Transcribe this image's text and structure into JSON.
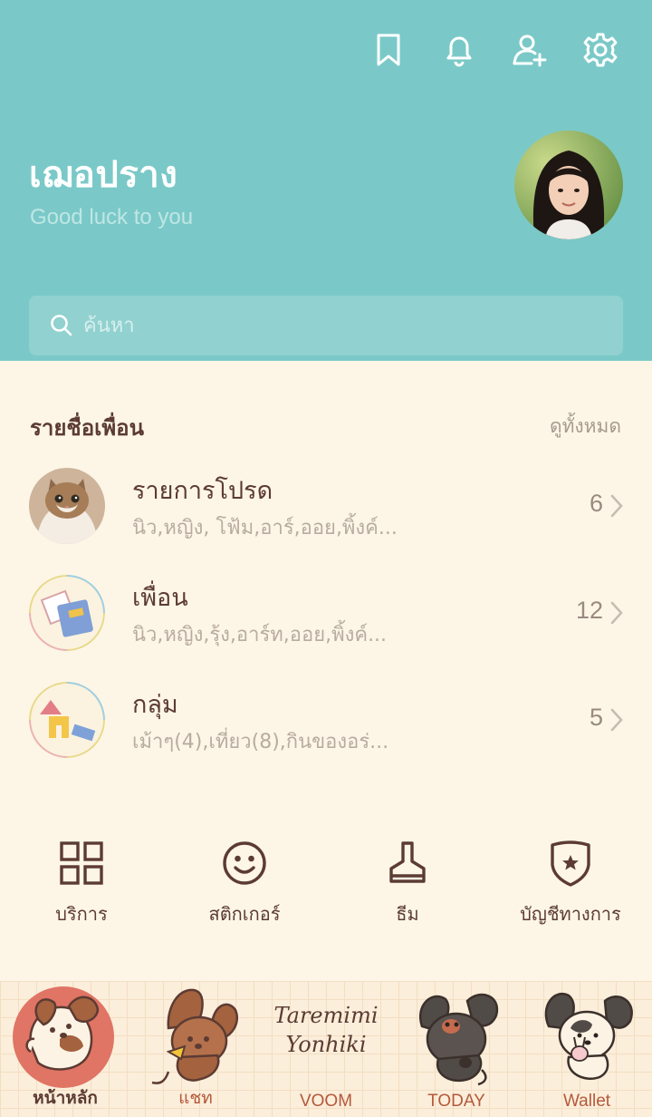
{
  "header": {
    "profile_name": "เฌอปราง",
    "status_message": "Good luck to you",
    "top_icons": [
      "bookmark-icon",
      "bell-icon",
      "add-friend-icon",
      "gear-icon"
    ]
  },
  "search": {
    "placeholder": "ค้นหา"
  },
  "friends": {
    "title": "รายชื่อเพื่อน",
    "see_all": "ดูทั้งหมด",
    "items": [
      {
        "title": "รายการโปรด",
        "subtitle": "นิว,หญิง, โฟ้ม,อาร์,ออย,พิ้งค์...",
        "count": "6"
      },
      {
        "title": "เพื่อน",
        "subtitle": "นิว,หญิง,รุ้ง,อาร์ท,ออย,พิ้งค์...",
        "count": "12"
      },
      {
        "title": "กลุ่ม",
        "subtitle": "เม้าๆ(4),เที่ยว(8),กินของอร่...",
        "count": "5"
      }
    ]
  },
  "shortcuts": [
    {
      "label": "บริการ",
      "icon": "grid-icon"
    },
    {
      "label": "สติกเกอร์",
      "icon": "smiley-icon"
    },
    {
      "label": "ธีม",
      "icon": "brush-icon"
    },
    {
      "label": "บัญชีทางการ",
      "icon": "shield-star-icon"
    }
  ],
  "bottom_nav": {
    "logo_text_1": "Taremimi",
    "logo_text_2": "Yonhiki",
    "items": [
      {
        "label": "หน้าหลัก",
        "active": true
      },
      {
        "label": "แชท",
        "active": false
      },
      {
        "label": "VOOM",
        "active": false
      },
      {
        "label": "TODAY",
        "active": false
      },
      {
        "label": "Wallet",
        "active": false
      }
    ]
  },
  "colors": {
    "header": "#7ac9c8",
    "background": "#fdf6e7",
    "text_brown": "#5c3b33",
    "nav_accent": "#b5593b"
  }
}
